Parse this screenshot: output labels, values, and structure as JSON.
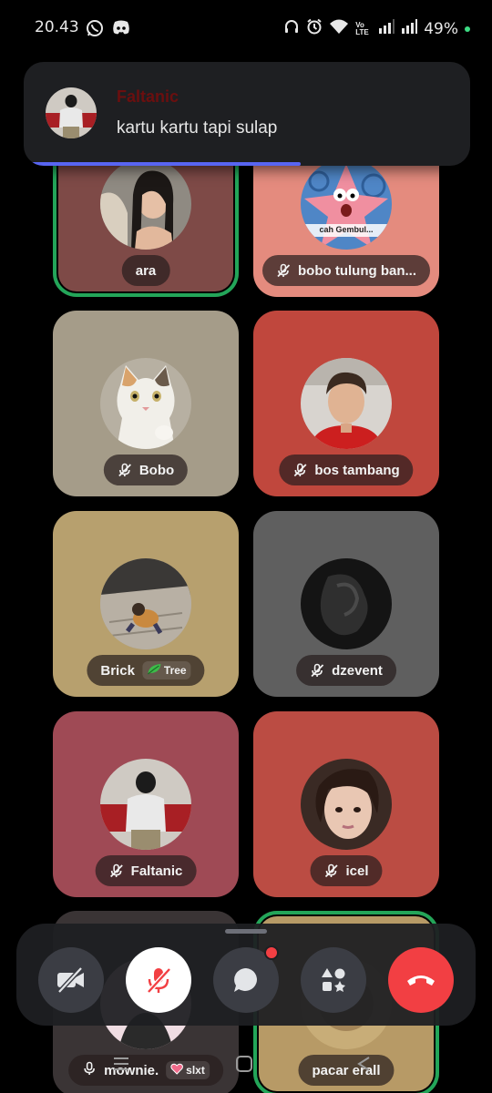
{
  "status_bar": {
    "time": "20.43",
    "left_icons": [
      "whatsapp-icon",
      "discord-icon"
    ],
    "right_icons": [
      "headphones-icon",
      "alarm-icon",
      "wifi-icon",
      "volte-icon",
      "signal-icon",
      "signal-icon"
    ],
    "volte_text": "Vo LTE",
    "battery": "49%"
  },
  "notification": {
    "sender": "Faltanic",
    "message": "kartu kartu tapi sulap",
    "colors": {
      "progress": "#5865f2",
      "sender": "#6b0f0f"
    }
  },
  "participants": [
    {
      "name": "ara",
      "muted": false,
      "speaking": true,
      "color": "#7e4a47",
      "avatar_icon": "profile-photo-icon"
    },
    {
      "name": "bobo tulung ban...",
      "muted": true,
      "speaking": false,
      "color": "#e48b7e",
      "avatar_icon": "patrick-sticker-icon",
      "avatar_caption": "cah Gembul..."
    },
    {
      "name": "Bobo",
      "muted": true,
      "speaking": false,
      "color": "#a59c89",
      "avatar_icon": "cat-photo-icon"
    },
    {
      "name": "bos tambang",
      "muted": true,
      "speaking": false,
      "color": "#c0473d",
      "avatar_icon": "profile-photo-icon"
    },
    {
      "name": "Brick",
      "muted": false,
      "speaking": false,
      "color": "#b7a06e",
      "avatar_icon": "cat-photo-icon",
      "badge": {
        "icon": "leaf-icon",
        "text": "Tree"
      }
    },
    {
      "name": "dzevent",
      "muted": true,
      "speaking": false,
      "color": "#5f5f5f",
      "avatar_icon": "profile-photo-icon"
    },
    {
      "name": "Faltanic",
      "muted": true,
      "speaking": false,
      "color": "#9f4a55",
      "avatar_icon": "profile-photo-icon"
    },
    {
      "name": "icel",
      "muted": true,
      "speaking": false,
      "color": "#bb4c43",
      "avatar_icon": "profile-photo-icon"
    },
    {
      "name": "mownie.",
      "muted": false,
      "speaking": false,
      "color": "#3a3435",
      "avatar_icon": "profile-photo-icon",
      "badge": {
        "icon": "heart-icon",
        "text": "slxt"
      }
    },
    {
      "name": "pacar erall",
      "muted": false,
      "speaking": true,
      "color": "#b79a66",
      "avatar_icon": "profile-photo-icon"
    }
  ],
  "call_controls": [
    {
      "name": "camera-off-button",
      "icon": "camera-off-icon",
      "bg": "#3b3d44"
    },
    {
      "name": "mute-toggle-button",
      "icon": "mic-off-icon",
      "bg": "#ffffff"
    },
    {
      "name": "chat-button",
      "icon": "chat-bubble-icon",
      "bg": "#3b3d44",
      "notification_dot": true
    },
    {
      "name": "activities-button",
      "icon": "activities-icon",
      "bg": "#3b3d44"
    },
    {
      "name": "end-call-button",
      "icon": "hang-up-icon",
      "bg": "#f23f43"
    }
  ],
  "nav_bar": [
    "recents-icon",
    "home-icon",
    "back-icon"
  ],
  "colors": {
    "speaking_ring": "#23a559",
    "accent_red": "#f23f43"
  }
}
